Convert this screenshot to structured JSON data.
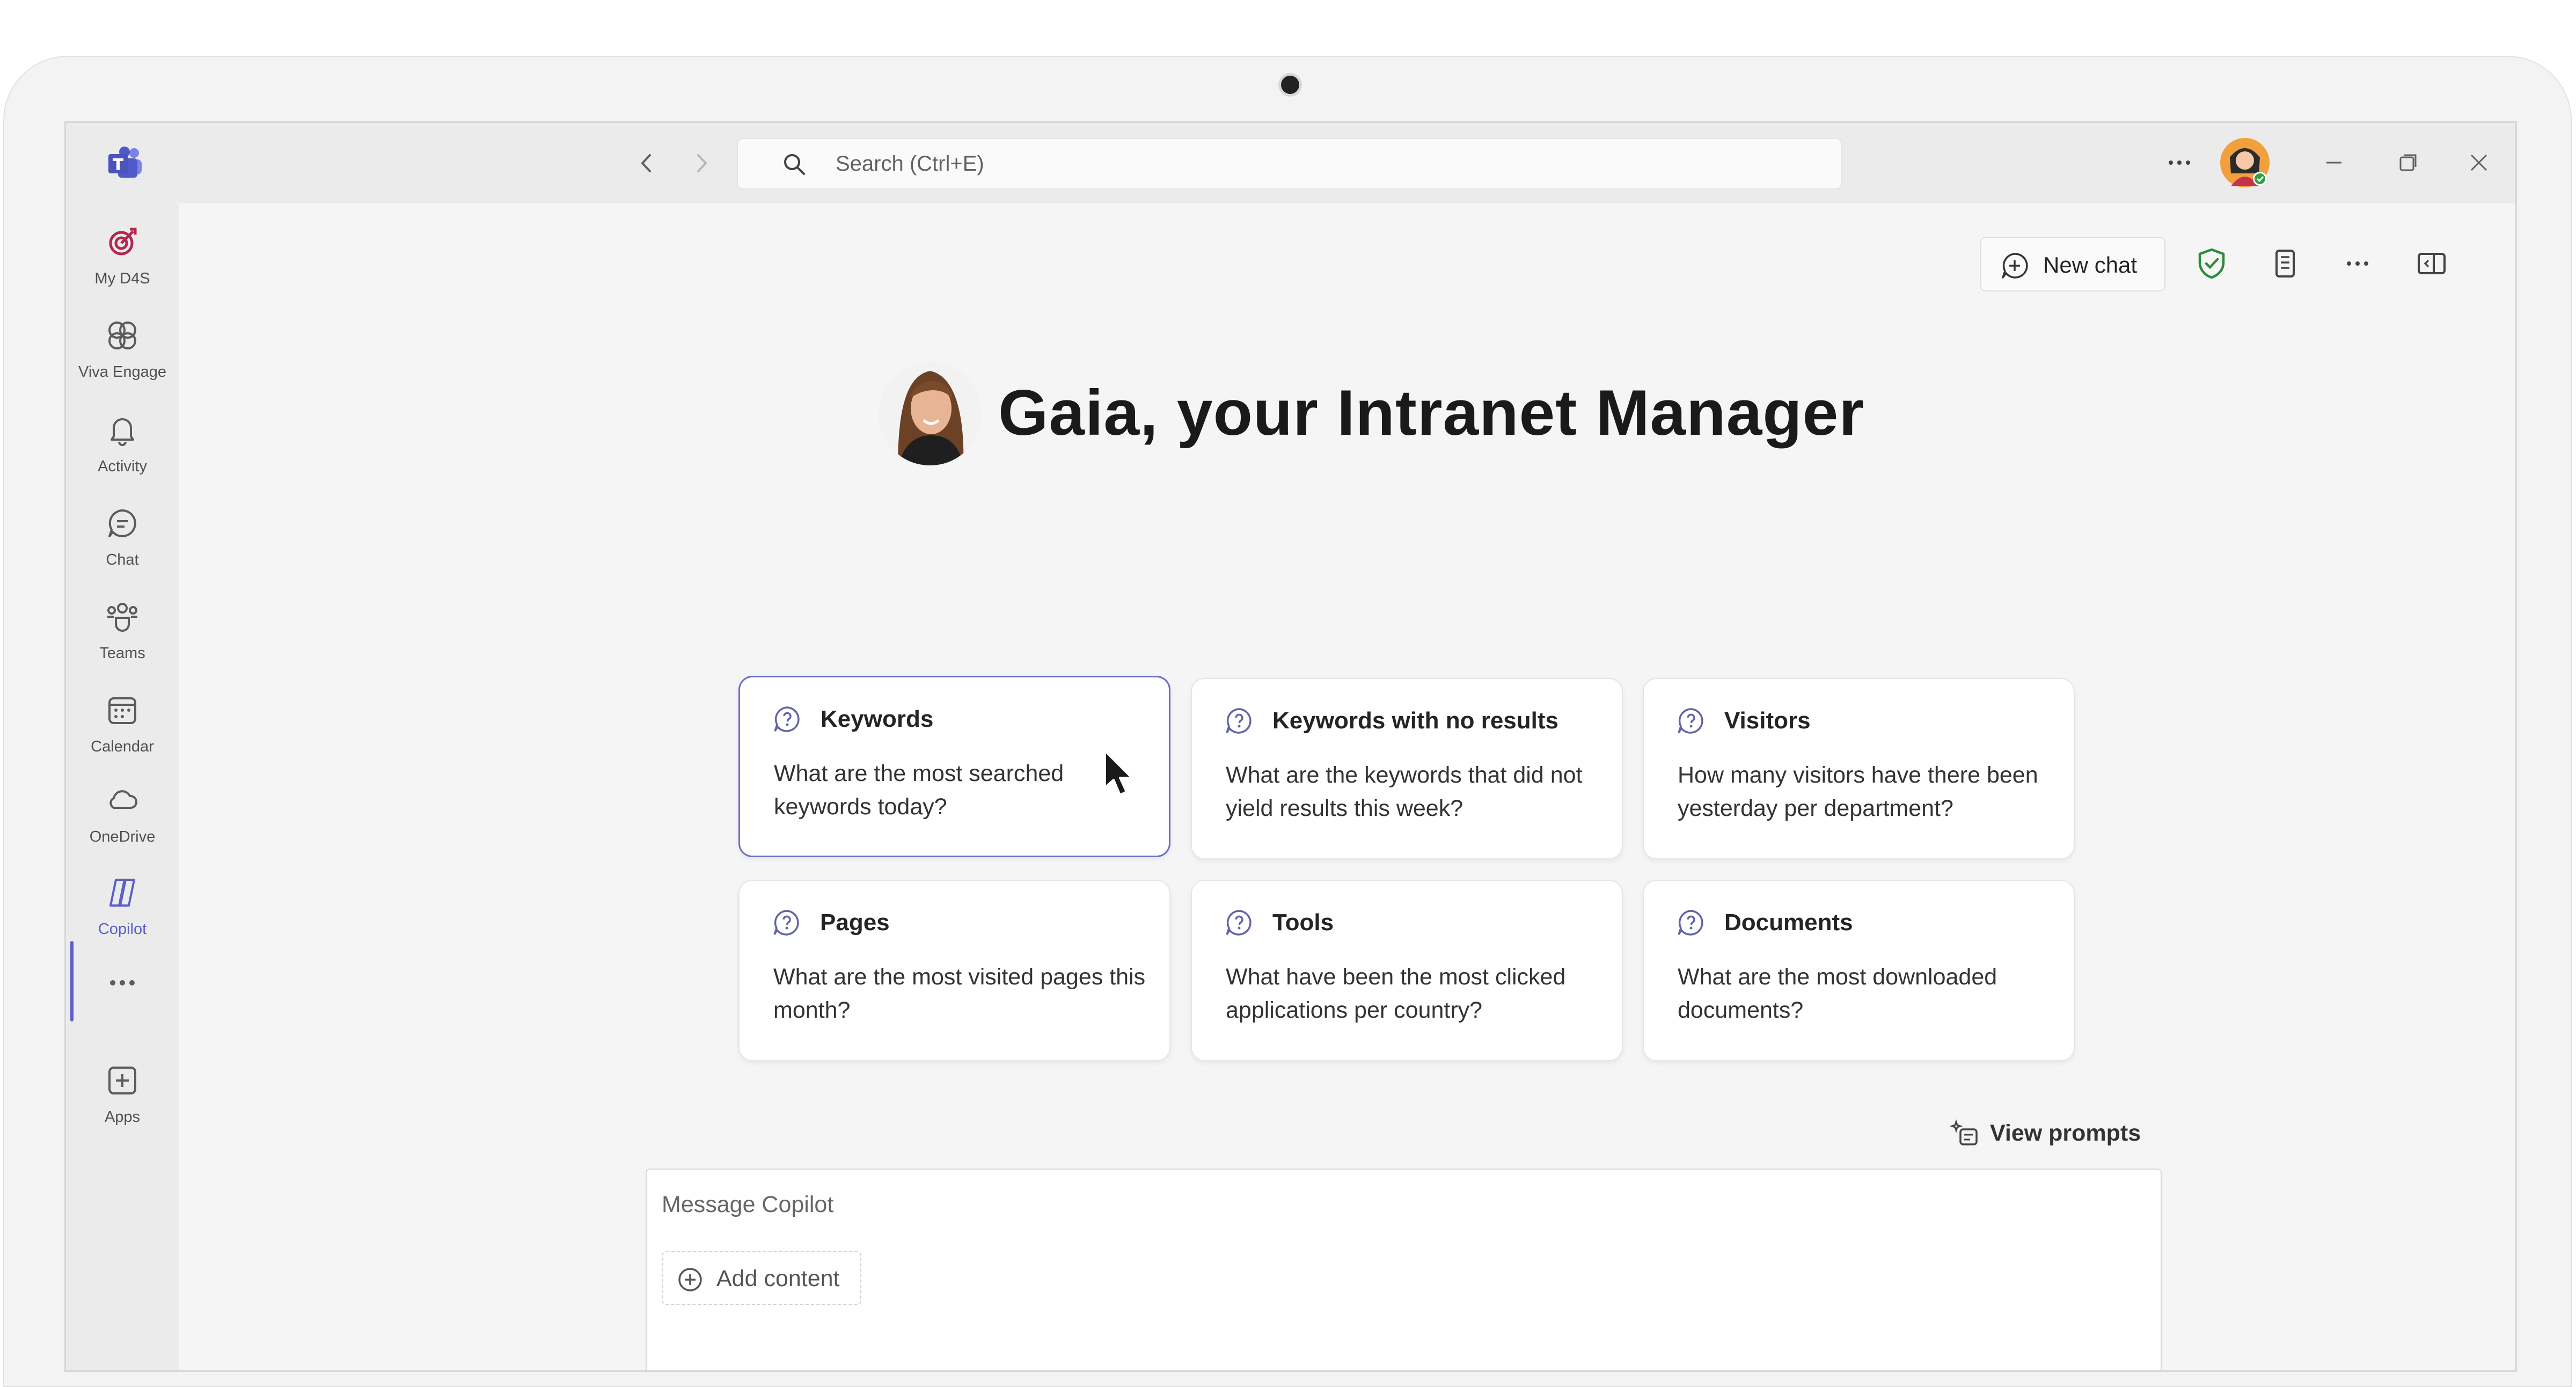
{
  "search": {
    "placeholder": "Search (Ctrl+E)"
  },
  "rail": {
    "items": [
      {
        "label": "My D4S",
        "icon": "target-icon"
      },
      {
        "label": "Viva Engage",
        "icon": "viva-engage-icon"
      },
      {
        "label": "Activity",
        "icon": "bell-icon"
      },
      {
        "label": "Chat",
        "icon": "chat-icon"
      },
      {
        "label": "Teams",
        "icon": "teams-icon"
      },
      {
        "label": "Calendar",
        "icon": "calendar-icon"
      },
      {
        "label": "OneDrive",
        "icon": "cloud-icon"
      },
      {
        "label": "Copilot",
        "icon": "copilot-icon",
        "active": true
      },
      {
        "label": "",
        "icon": "more-icon"
      },
      {
        "label": "Apps",
        "icon": "add-app-icon"
      }
    ]
  },
  "header": {
    "new_chat_label": "New chat"
  },
  "hero": {
    "title": "Gaia, your Intranet Manager"
  },
  "cards": [
    {
      "title": "Keywords",
      "text": "What are the most searched keywords today?",
      "selected": true
    },
    {
      "title": "Keywords with no results",
      "text": "What are the keywords that did not yield results this week?"
    },
    {
      "title": "Visitors",
      "text": "How many visitors have there been yesterday per department?"
    },
    {
      "title": "Pages",
      "text": "What are the most visited pages this month?"
    },
    {
      "title": "Tools",
      "text": "What have been the most clicked applications per country?"
    },
    {
      "title": "Documents",
      "text": "What are the most downloaded documents?"
    }
  ],
  "view_prompts_label": "View prompts",
  "composer": {
    "placeholder": "Message Copilot",
    "add_content_label": "Add content"
  },
  "colors": {
    "accent": "#5b5fc7",
    "shield": "#2e8b3e",
    "card_border_selected": "#6b6ec9"
  }
}
